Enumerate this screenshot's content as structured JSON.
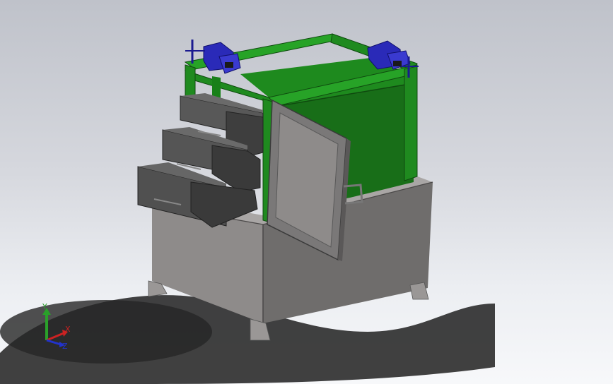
{
  "viewport": {
    "triad": {
      "x_label": "X",
      "y_label": "Y",
      "z_label": "Z"
    }
  },
  "colors": {
    "frame_green": "#1f8a1f",
    "box_green": "#176f17",
    "cabinet_gray": "#8b8887",
    "drawer_dark": "#4a4a4a",
    "vise_blue": "#2a2ab8",
    "shadow": "#2a2a2a"
  },
  "model": {
    "parts": [
      "vise-left",
      "vise-right",
      "green-frame",
      "green-enclosure",
      "door",
      "drawers",
      "base-cabinet",
      "feet"
    ]
  }
}
